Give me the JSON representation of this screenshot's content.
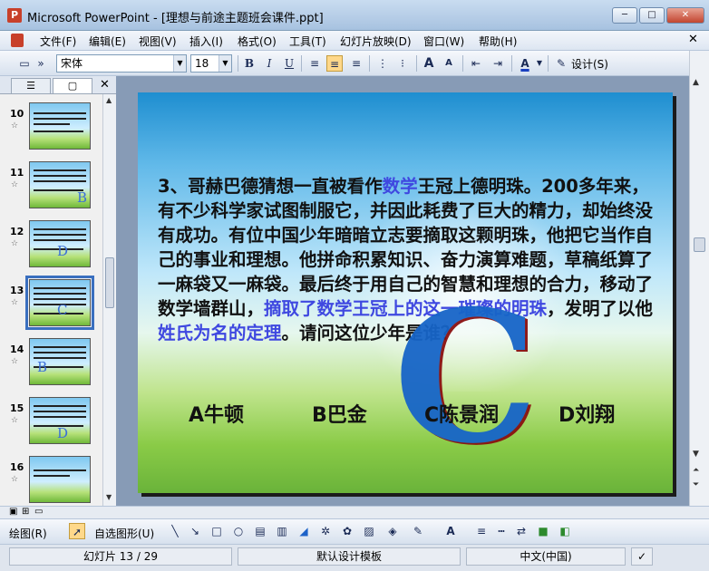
{
  "window": {
    "title": "Microsoft PowerPoint - [理想与前途主题班会课件.ppt]",
    "minimize": "─",
    "maximize": "□",
    "close": "✕"
  },
  "menu": {
    "items": [
      "文件(F)",
      "编辑(E)",
      "视图(V)",
      "插入(I)",
      "格式(O)",
      "工具(T)",
      "幻灯片放映(D)",
      "窗口(W)",
      "帮助(H)"
    ],
    "close": "✕"
  },
  "toolbar": {
    "font": "宋体",
    "size": "18",
    "bold": "B",
    "italic": "I",
    "underline": "U",
    "design": "设计(S)",
    "grow": "A",
    "shrink": "A",
    "font_color": "A"
  },
  "left_panel": {
    "tabs": [
      "☰",
      "▢"
    ],
    "close": "✕",
    "slides": [
      {
        "num": "10"
      },
      {
        "num": "11",
        "letter": "B"
      },
      {
        "num": "12",
        "letter": "D"
      },
      {
        "num": "13",
        "letter": "C",
        "selected": true
      },
      {
        "num": "14",
        "letter": "B"
      },
      {
        "num": "15",
        "letter": "D"
      },
      {
        "num": "16"
      }
    ]
  },
  "slide": {
    "question": {
      "p1": "3、哥赫巴德猜想一直被看作",
      "b1": "数学",
      "p2": "王冠上德明珠。200多年来，有不少科学家试图制服它，并因此耗费了巨大的精力，却始终没有成功。有位中国少年暗暗立志要摘取这颗明珠，他把它当作自己的事业和理想。他拼命积累知识、奋力演算难题，草稿纸算了一麻袋又一麻袋。最后终于用自己的智慧和理想的合力，移动了数学墙群山，",
      "b2": "摘取了数学王冠上的这一璀璨的明珠",
      "p3": "，发明了以他",
      "b3": "姓氏为名的定理",
      "p4": "。请问这位少年是谁？"
    },
    "answers": [
      "A牛顿",
      "B巴金",
      "C陈景润",
      "D刘翔"
    ],
    "big_letter": "C"
  },
  "drawbar": {
    "draw": "绘图(R)",
    "autoshape": "自选图形(U)"
  },
  "status": {
    "slide": "幻灯片 13 / 29",
    "template": "默认设计模板",
    "language": "中文(中国)"
  }
}
